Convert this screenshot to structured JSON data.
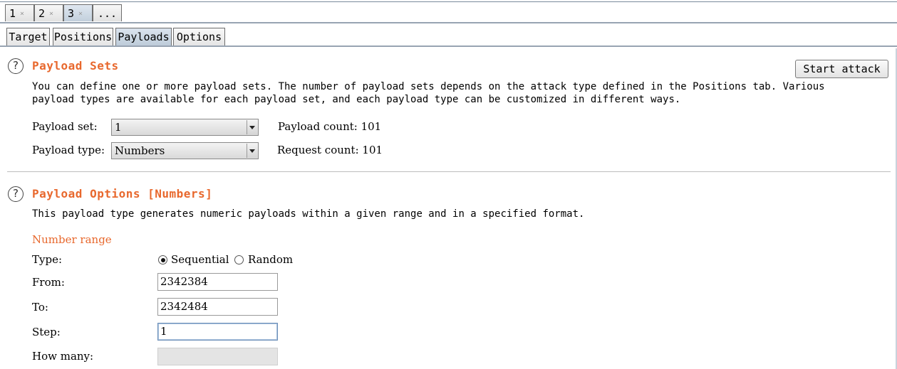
{
  "attack_tabs": [
    {
      "label": "1",
      "close": "×"
    },
    {
      "label": "2",
      "close": "×"
    },
    {
      "label": "3",
      "close": "×"
    },
    {
      "label": "..."
    }
  ],
  "sub_tabs": [
    "Target",
    "Positions",
    "Payloads",
    "Options"
  ],
  "payload_sets": {
    "title": "Payload Sets",
    "help": "?",
    "description_line1": "You can define one or more payload sets. The number of payload sets depends on the attack type defined in the Positions tab. Various",
    "description_line2": "payload types are available for each payload set, and each payload type can be customized in different ways.",
    "set_label": "Payload set:",
    "set_value": "1",
    "type_label": "Payload type:",
    "type_value": "Numbers",
    "payload_count": "Payload count: 101",
    "request_count": "Request count: 101",
    "start_attack": "Start attack"
  },
  "payload_options": {
    "title": "Payload Options [Numbers]",
    "help": "?",
    "description": "This payload type generates numeric payloads within a given range and in a specified format.",
    "number_range": "Number range",
    "type_label": "Type:",
    "sequential": "Sequential",
    "random": "Random",
    "from_label": "From:",
    "from_value": "2342384",
    "to_label": "To:",
    "to_value": "2342484",
    "step_label": "Step:",
    "step_value": "1",
    "how_many_label": "How many:",
    "how_many_value": ""
  }
}
